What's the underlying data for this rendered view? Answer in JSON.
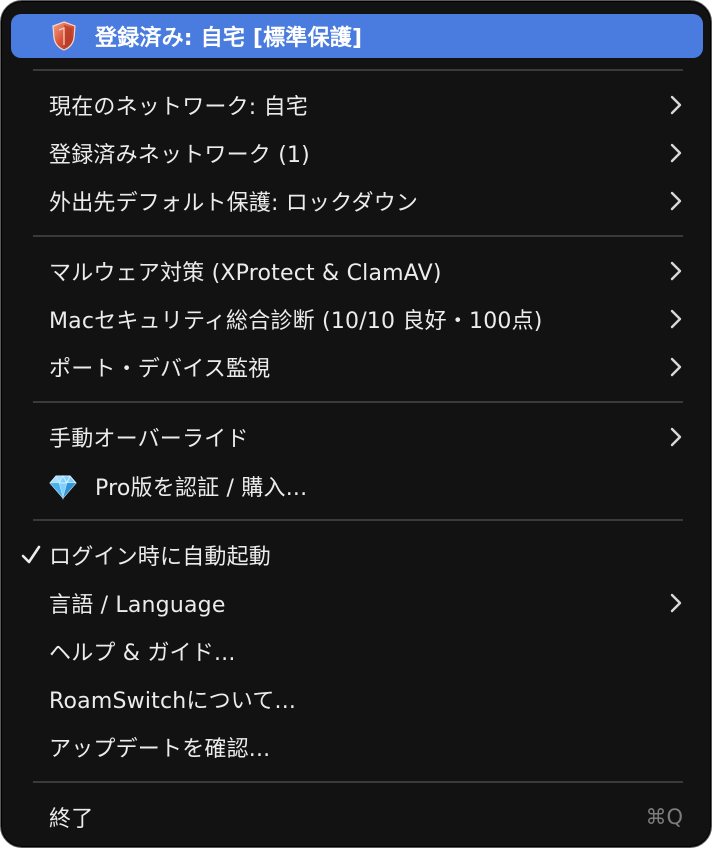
{
  "header": {
    "title": "登録済み: 自宅 [標準保護]",
    "icon": "shield-icon",
    "accent_color": "#4a7bde"
  },
  "groups": [
    {
      "items": [
        {
          "label": "現在のネットワーク: 自宅",
          "submenu": true
        },
        {
          "label": "登録済みネットワーク (1)",
          "submenu": true
        },
        {
          "label": "外出先デフォルト保護: ロックダウン",
          "submenu": true
        }
      ]
    },
    {
      "items": [
        {
          "label": "マルウェア対策 (XProtect & ClamAV)",
          "submenu": true
        },
        {
          "label": "Macセキュリティ総合診断 (10/10 良好・100点)",
          "submenu": true
        },
        {
          "label": "ポート・デバイス監視",
          "submenu": true
        }
      ]
    },
    {
      "items": [
        {
          "label": "手動オーバーライド",
          "submenu": true
        },
        {
          "label": "Pro版を認証 / 購入...",
          "icon": "gem-icon"
        }
      ]
    },
    {
      "items": [
        {
          "label": "ログイン時に自動起動",
          "checked": true
        },
        {
          "label": "言語 / Language",
          "submenu": true
        },
        {
          "label": "ヘルプ & ガイド..."
        },
        {
          "label": "RoamSwitchについて..."
        },
        {
          "label": "アップデートを確認..."
        }
      ]
    }
  ],
  "quit": {
    "label": "終了",
    "shortcut": "⌘Q"
  }
}
